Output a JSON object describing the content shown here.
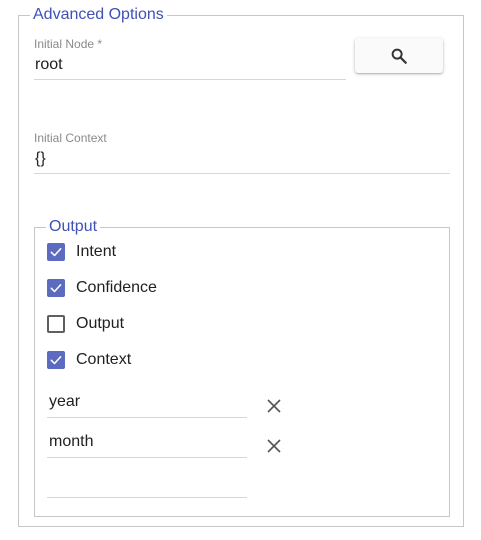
{
  "advanced_options": {
    "legend": "Advanced Options",
    "initial_node": {
      "label": "Initial Node *",
      "value": "root"
    },
    "search_button": {
      "icon": "search-icon"
    },
    "initial_context": {
      "label": "Initial Context",
      "value": "{}"
    },
    "output": {
      "legend": "Output",
      "options": [
        {
          "label": "Intent",
          "checked": true
        },
        {
          "label": "Confidence",
          "checked": true
        },
        {
          "label": "Output",
          "checked": false
        },
        {
          "label": "Context",
          "checked": true
        }
      ],
      "context_keys": [
        {
          "value": "year",
          "remove_icon": "close-icon"
        },
        {
          "value": "month",
          "remove_icon": "close-icon"
        },
        {
          "value": ""
        }
      ]
    }
  },
  "colors": {
    "accent": "#3f51b5",
    "checkbox_checked": "#5c6bc0",
    "label_gray": "#8a8a8a",
    "border": "#c6c6c6"
  }
}
